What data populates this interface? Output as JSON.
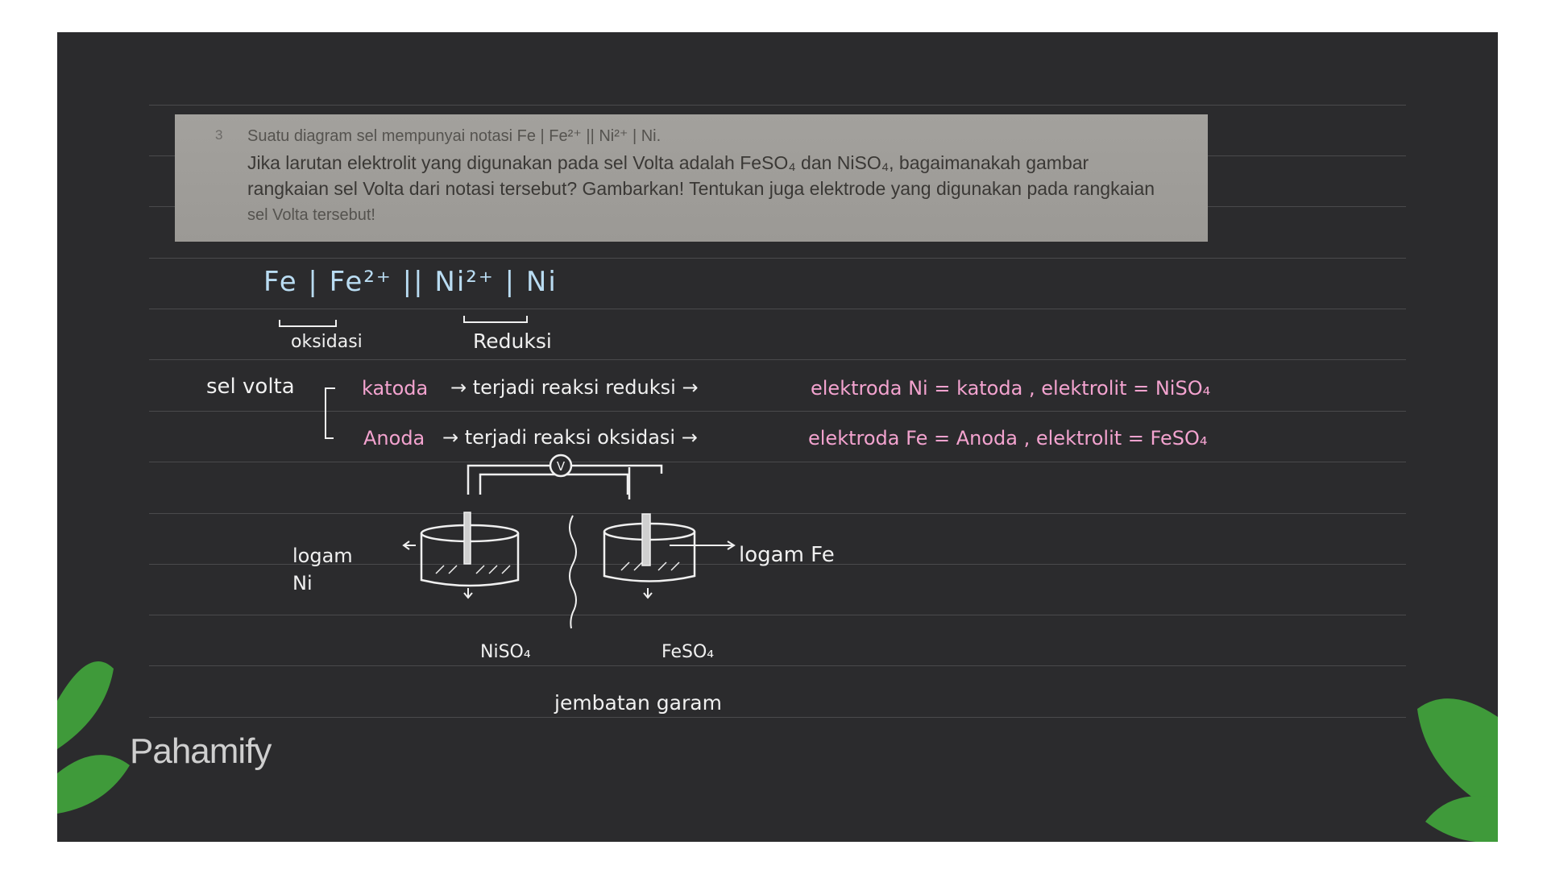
{
  "question": {
    "number": "3",
    "line1": "Suatu diagram sel mempunyai notasi Fe | Fe²⁺ || Ni²⁺ | Ni.",
    "line2": "Jika larutan elektrolit yang digunakan pada sel Volta adalah FeSO₄ dan NiSO₄, bagaimanakah gambar",
    "line3": "rangkaian sel Volta dari notasi tersebut? Gambarkan! Tentukan juga elektrode yang digunakan pada rangkaian",
    "line4": "sel Volta tersebut!"
  },
  "notation": "Fe | Fe²⁺ || Ni²⁺ | Ni",
  "labels": {
    "oksidasi": "oksidasi",
    "reduksi": "Reduksi",
    "sel_volta": "sel volta",
    "katoda": "katoda",
    "katoda_arrow": "→ terjadi reaksi reduksi →",
    "katoda_result": "elektroda Ni = katoda , elektrolit = NiSO₄",
    "anoda": "Anoda",
    "anoda_arrow": "→ terjadi reaksi oksidasi →",
    "anoda_result": "elektroda Fe = Anoda , elektrolit = FeSO₄"
  },
  "diagram": {
    "voltmeter": "V",
    "logam_ni": "logam Ni",
    "logam_fe": "logam Fe",
    "niso4": "NiSO₄",
    "feso4": "FeSO₄",
    "jembatan": "jembatan garam"
  },
  "brand": "Pahamify",
  "colors": {
    "board": "#2b2b2d",
    "white_ink": "#f0f0f0",
    "blue_ink": "#b9dcf2",
    "pink_ink": "#f3a3cf",
    "leaf": "#3f9a3a"
  }
}
